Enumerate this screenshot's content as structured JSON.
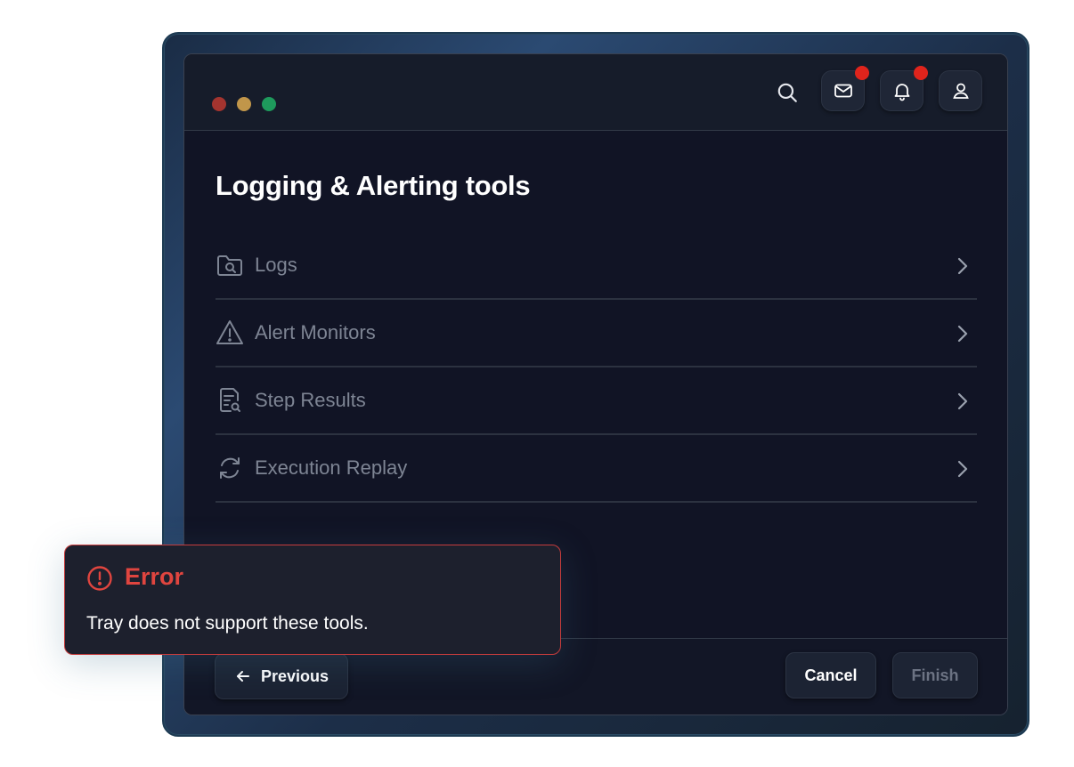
{
  "header": {
    "icons": [
      "search-icon",
      "mail-icon",
      "bell-icon",
      "user-icon"
    ],
    "mail_badge": true,
    "bell_badge": true
  },
  "main": {
    "title": "Logging & Alerting tools",
    "items": [
      {
        "label": "Logs",
        "icon": "folder-search-icon"
      },
      {
        "label": "Alert Monitors",
        "icon": "warning-icon"
      },
      {
        "label": "Step Results",
        "icon": "document-search-icon"
      },
      {
        "label": "Execution Replay",
        "icon": "refresh-icon"
      }
    ]
  },
  "footer": {
    "previous_label": "Previous",
    "cancel_label": "Cancel",
    "finish_label": "Finish"
  },
  "toast": {
    "title": "Error",
    "message": "Tray does not support these tools."
  },
  "colors": {
    "error": "#e0453f",
    "badge": "#e0241c",
    "window_bg": "#111425"
  }
}
